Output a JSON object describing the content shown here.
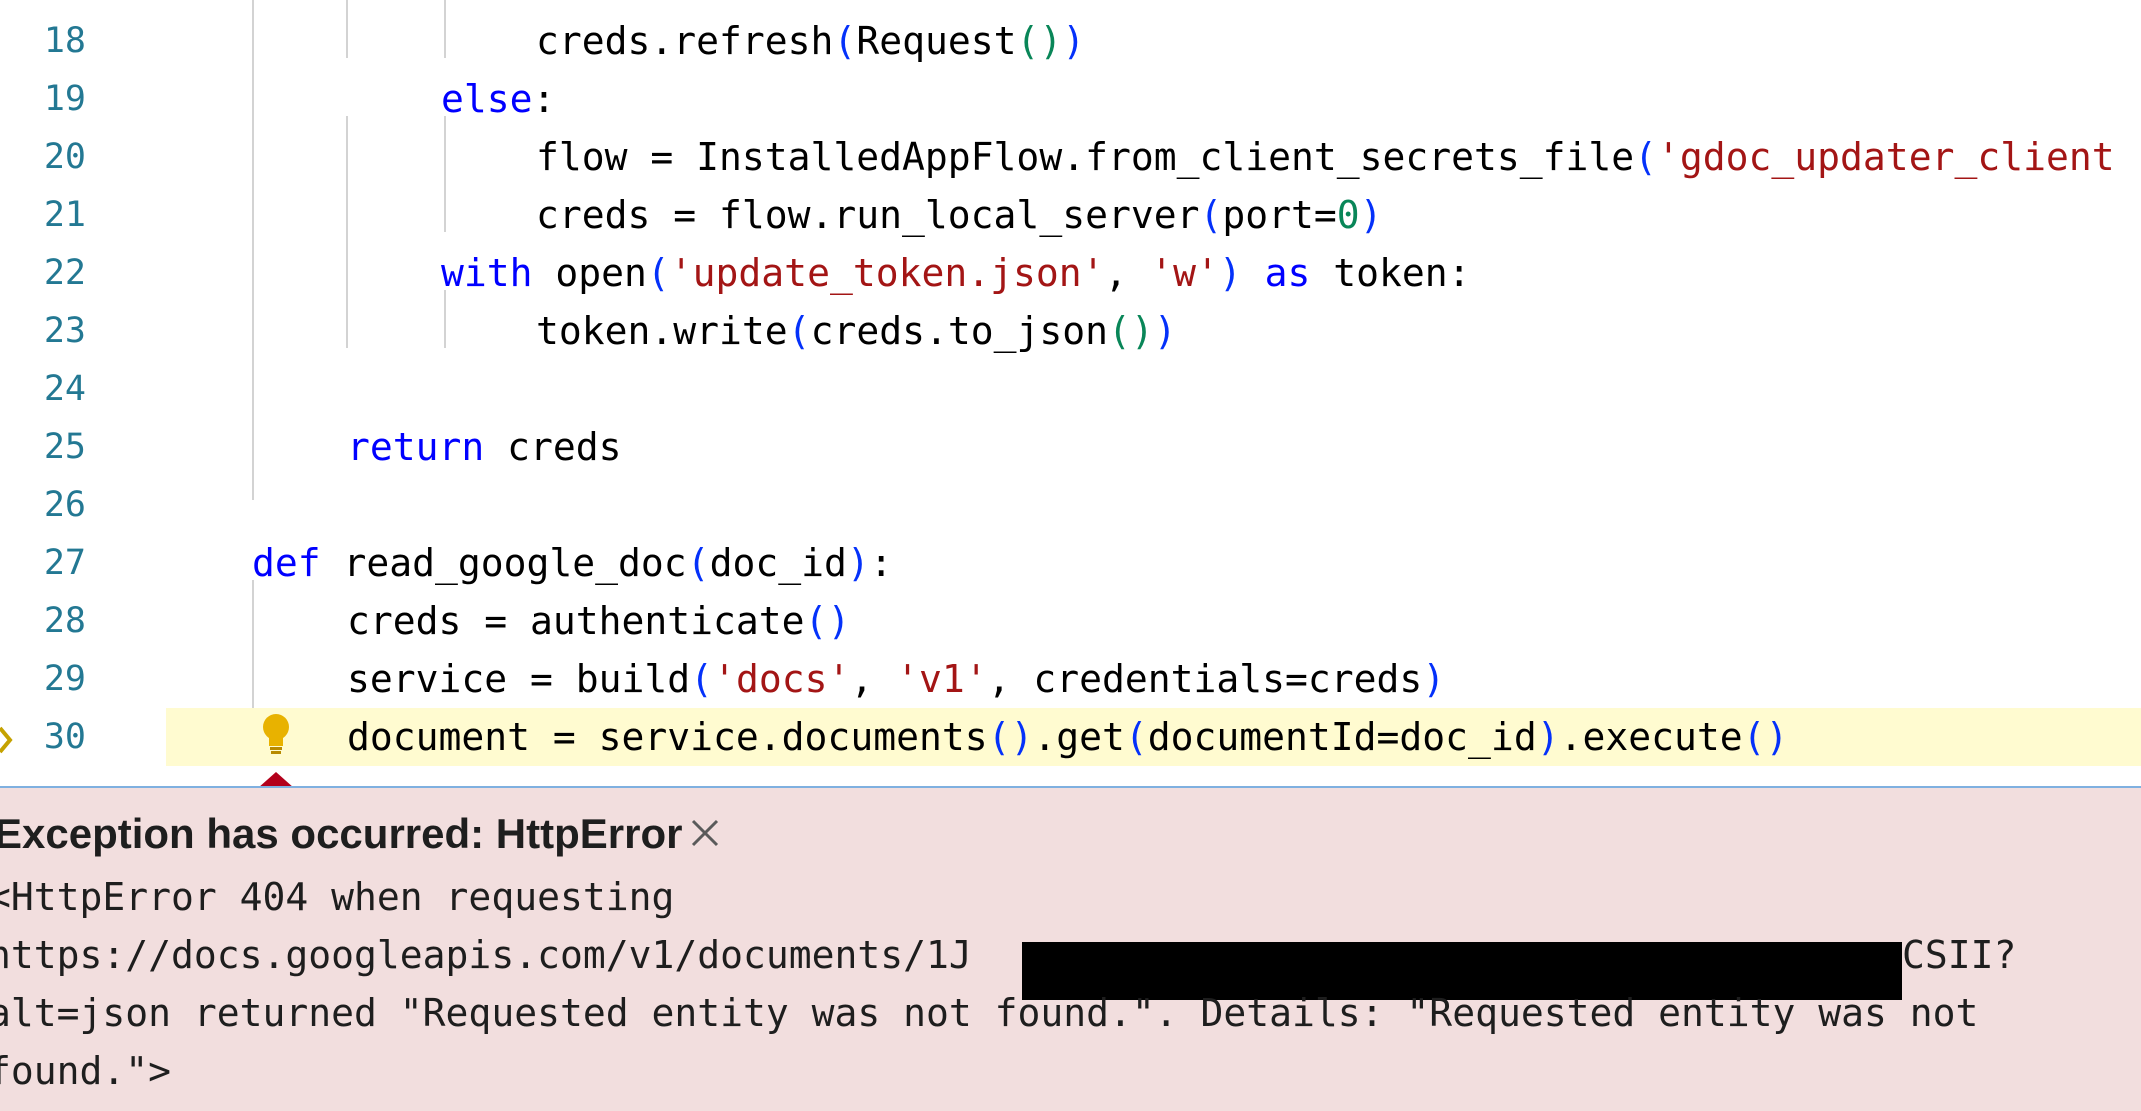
{
  "editor": {
    "current_line": "30",
    "lines": [
      {
        "n": "18",
        "tokens": [
          "creds.refresh",
          "(",
          "Request",
          "()",
          ")"
        ]
      },
      {
        "n": "19",
        "tokens": [
          "else",
          ":"
        ]
      },
      {
        "n": "20",
        "tokens": [
          "flow = InstalledAppFlow.from_client_secrets_file",
          "(",
          "'gdoc_updater_client"
        ]
      },
      {
        "n": "21",
        "tokens": [
          "creds = flow.run_local_server",
          "(",
          "port=",
          "0",
          ")"
        ]
      },
      {
        "n": "22",
        "tokens": [
          "with",
          " open",
          "(",
          "'update_token.json'",
          ", ",
          "'w'",
          ")",
          " as",
          " token:"
        ]
      },
      {
        "n": "23",
        "tokens": [
          "token.write",
          "(",
          "creds.to_json",
          "()",
          ")"
        ]
      },
      {
        "n": "24",
        "tokens": []
      },
      {
        "n": "25",
        "tokens": [
          "return",
          " creds"
        ]
      },
      {
        "n": "26",
        "tokens": []
      },
      {
        "n": "27",
        "tokens": [
          "def",
          " read_google_doc",
          "(",
          "doc_id",
          ")",
          ":"
        ]
      },
      {
        "n": "28",
        "tokens": [
          "creds = authenticate",
          "()"
        ]
      },
      {
        "n": "29",
        "tokens": [
          "service = build",
          "(",
          "'docs'",
          ", ",
          "'v1'",
          ", credentials=creds",
          ")"
        ]
      },
      {
        "n": "30",
        "tokens": [
          "document = service.documents",
          "()",
          ".get",
          "(",
          "documentId=doc_id",
          ")",
          ".execute",
          "()"
        ]
      }
    ]
  },
  "exception": {
    "title": "Exception has occurred: HttpError",
    "close_icon": "close-icon",
    "message_lines": [
      "<HttpError 404 when requesting",
      "https://docs.googleapis.com/v1/documents/1J",
      "alt=json returned \"Requested entity was not found.\". Details: \"Requested entity was not",
      "found.\">"
    ],
    "message_tail": "CSII?"
  },
  "icons": {
    "lightbulb": "lightbulb-icon",
    "breakpoint_pointer": "current-line-arrow-icon"
  },
  "colors": {
    "keyword": "#0000ff",
    "string": "#a31515",
    "number": "#098658",
    "bracket": "#0431fa",
    "line_number": "#237893",
    "current_line_bg": "#fffbd0",
    "exception_bg": "#f2dede"
  }
}
